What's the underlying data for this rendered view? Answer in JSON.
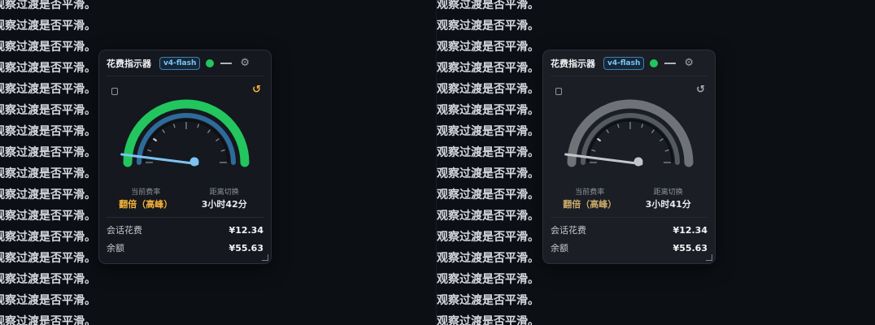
{
  "background": {
    "line_text": "观察过渡是否平滑。",
    "line_count": 16
  },
  "widgets": [
    {
      "variant": "active",
      "title": "花费指示器",
      "badge": "v4-flash",
      "status_color": "#22c55e",
      "minimize_icon": "minus-icon",
      "settings_icon": "gear-icon",
      "reset_icon": "refresh-icon",
      "reset_color": "#f5b23a",
      "gauge_level": 0.04,
      "gauge_colors": {
        "outer": "#22c55e",
        "inner": "#2f6b9a",
        "needle": "#7dc3f0",
        "hub": "#7dc3f0"
      },
      "rate_label": "当前费率",
      "rate_value": "翻倍（高峰）",
      "switch_label": "距离切换",
      "switch_value": "3小时42分",
      "session_label": "会话花费",
      "session_value": "¥12.34",
      "balance_label": "余额",
      "balance_value": "¥55.63"
    },
    {
      "variant": "dimmed",
      "title": "花费指示器",
      "badge": "v4-flash",
      "status_color": "#22c55e",
      "minimize_icon": "minus-icon",
      "settings_icon": "gear-icon",
      "reset_icon": "refresh-icon",
      "reset_color": "#a5abb3",
      "gauge_level": 0.04,
      "gauge_colors": {
        "outer": "#6f7378",
        "inner": "#555a60",
        "needle": "#c2c6cb",
        "hub": "#c2c6cb"
      },
      "rate_label": "当前费率",
      "rate_value": "翻倍（高峰）",
      "switch_label": "距离切换",
      "switch_value": "3小时41分",
      "session_label": "会话花费",
      "session_value": "¥12.34",
      "balance_label": "余额",
      "balance_value": "¥55.63"
    }
  ]
}
